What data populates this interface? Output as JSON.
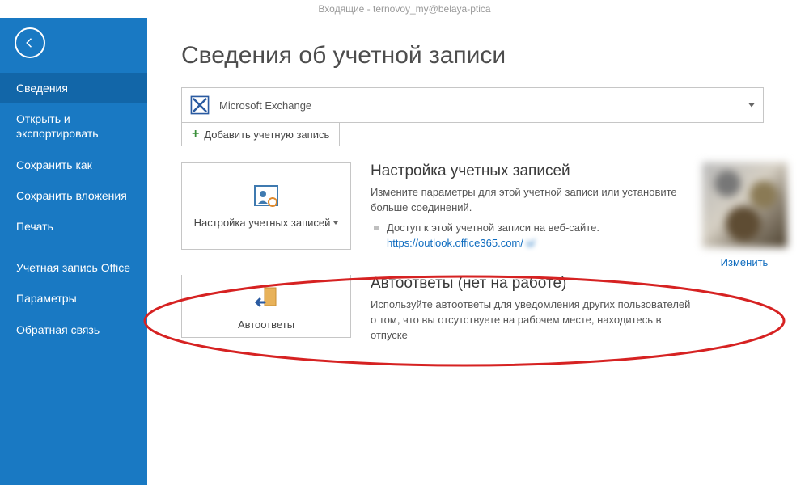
{
  "window_title": "Входящие - ternovoy_my@belaya-ptica",
  "sidebar": {
    "items": [
      {
        "label": "Сведения",
        "active": true
      },
      {
        "label": "Открыть и экспортировать"
      },
      {
        "label": "Сохранить как"
      },
      {
        "label": "Сохранить вложения"
      },
      {
        "label": "Печать"
      }
    ],
    "lower_items": [
      {
        "label": "Учетная запись Office"
      },
      {
        "label": "Параметры"
      },
      {
        "label": "Обратная связь"
      }
    ]
  },
  "main": {
    "title": "Сведения об учетной записи",
    "account": {
      "type_label": "Microsoft Exchange"
    },
    "add_account_label": "Добавить учетную запись",
    "settings_tile_label": "Настройка учетных записей",
    "settings": {
      "heading": "Настройка учетных записей",
      "description": "Измените параметры для этой учетной записи или установите больше соединений.",
      "bullet_text": "Доступ к этой учетной записи на веб-сайте.",
      "link_visible": "https://outlook.office365.com/",
      "link_blur_tail": "         u/"
    },
    "avatar_change_label": "Изменить",
    "autoreply_tile_label": "Автоответы",
    "autoreply": {
      "heading": "Автоответы (нет на работе)",
      "description": "Используйте автоответы для уведомления других пользователей о том, что вы отсутствуете на рабочем месте, находитесь в отпуске"
    }
  }
}
